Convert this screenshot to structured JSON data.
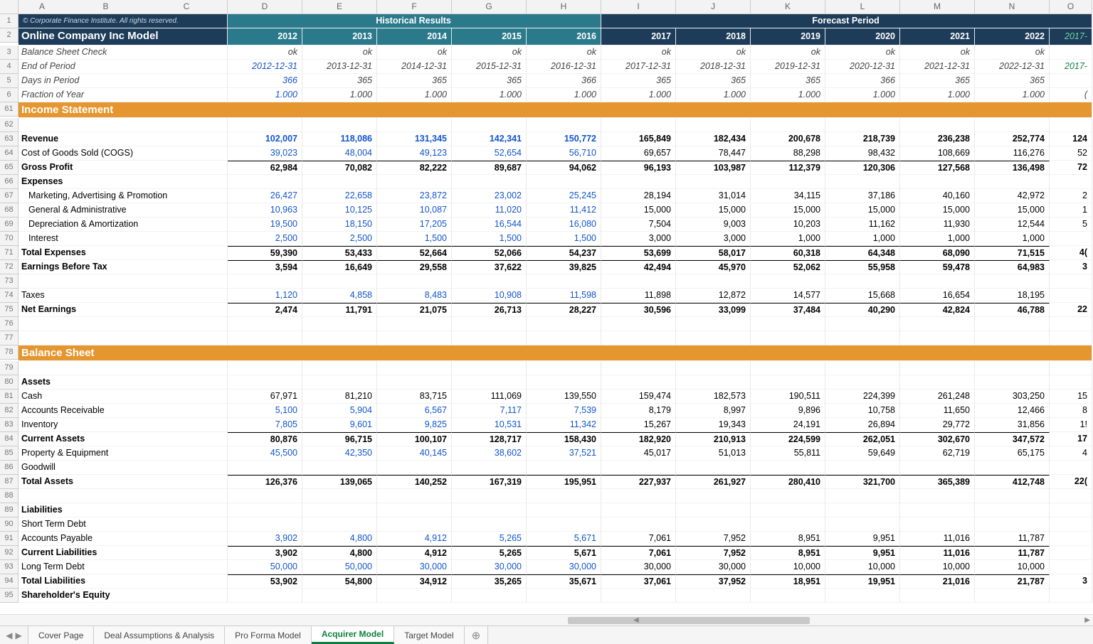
{
  "copyright": "© Corporate Finance Institute. All rights reserved.",
  "title": "Online Company Inc Model",
  "header_hist": "Historical Results",
  "header_fore": "Forecast Period",
  "cols": [
    "A",
    "B",
    "C",
    "D",
    "E",
    "F",
    "G",
    "H",
    "I",
    "J",
    "K",
    "L",
    "M",
    "N",
    "O"
  ],
  "row_ids": [
    "1",
    "2",
    "3",
    "4",
    "5",
    "6",
    "61",
    "62",
    "63",
    "64",
    "65",
    "66",
    "67",
    "68",
    "69",
    "70",
    "71",
    "72",
    "73",
    "74",
    "75",
    "76",
    "77",
    "78",
    "79",
    "80",
    "81",
    "82",
    "83",
    "84",
    "85",
    "86",
    "87",
    "88",
    "89",
    "90",
    "91",
    "92",
    "93",
    "94",
    "95"
  ],
  "years": [
    "2012",
    "2013",
    "2014",
    "2015",
    "2016",
    "2017",
    "2018",
    "2019",
    "2020",
    "2021",
    "2022"
  ],
  "year_partial_o": "2017-",
  "rows": {
    "bsc": {
      "label": "Balance Sheet Check",
      "vals": [
        "ok",
        "ok",
        "ok",
        "ok",
        "ok",
        "ok",
        "ok",
        "ok",
        "ok",
        "ok",
        "ok"
      ],
      "o": ""
    },
    "eop": {
      "label": "End of Period",
      "vals": [
        "2012-12-31",
        "2013-12-31",
        "2014-12-31",
        "2015-12-31",
        "2016-12-31",
        "2017-12-31",
        "2018-12-31",
        "2019-12-31",
        "2020-12-31",
        "2021-12-31",
        "2022-12-31"
      ],
      "o": "2017-"
    },
    "days": {
      "label": "Days in Period",
      "vals": [
        "366",
        "365",
        "365",
        "365",
        "366",
        "365",
        "365",
        "365",
        "366",
        "365",
        "365"
      ],
      "o": ""
    },
    "frac": {
      "label": "Fraction of Year",
      "vals": [
        "1.000",
        "1.000",
        "1.000",
        "1.000",
        "1.000",
        "1.000",
        "1.000",
        "1.000",
        "1.000",
        "1.000",
        "1.000"
      ],
      "o": "("
    },
    "income_hdr": "Income Statement",
    "rev": {
      "label": "Revenue",
      "vals": [
        "102,007",
        "118,086",
        "131,345",
        "142,341",
        "150,772",
        "165,849",
        "182,434",
        "200,678",
        "218,739",
        "236,238",
        "252,774"
      ],
      "o": "124"
    },
    "cogs": {
      "label": "Cost of Goods Sold (COGS)",
      "vals": [
        "39,023",
        "48,004",
        "49,123",
        "52,654",
        "56,710",
        "69,657",
        "78,447",
        "88,298",
        "98,432",
        "108,669",
        "116,276"
      ],
      "o": "52"
    },
    "gp": {
      "label": "Gross Profit",
      "vals": [
        "62,984",
        "70,082",
        "82,222",
        "89,687",
        "94,062",
        "96,193",
        "103,987",
        "112,379",
        "120,306",
        "127,568",
        "136,498"
      ],
      "o": "72"
    },
    "exp_hdr": "Expenses",
    "map": {
      "label": "Marketing, Advertising & Promotion",
      "vals": [
        "26,427",
        "22,658",
        "23,872",
        "23,002",
        "25,245",
        "28,194",
        "31,014",
        "34,115",
        "37,186",
        "40,160",
        "42,972"
      ],
      "o": "2"
    },
    "ga": {
      "label": "General & Administrative",
      "vals": [
        "10,963",
        "10,125",
        "10,087",
        "11,020",
        "11,412",
        "15,000",
        "15,000",
        "15,000",
        "15,000",
        "15,000",
        "15,000"
      ],
      "o": "1"
    },
    "da": {
      "label": "Depreciation & Amortization",
      "vals": [
        "19,500",
        "18,150",
        "17,205",
        "16,544",
        "16,080",
        "7,504",
        "9,003",
        "10,203",
        "11,162",
        "11,930",
        "12,544"
      ],
      "o": "5"
    },
    "intr": {
      "label": "Interest",
      "vals": [
        "2,500",
        "2,500",
        "1,500",
        "1,500",
        "1,500",
        "3,000",
        "3,000",
        "1,000",
        "1,000",
        "1,000",
        "1,000"
      ],
      "o": ""
    },
    "texp": {
      "label": "Total Expenses",
      "vals": [
        "59,390",
        "53,433",
        "52,664",
        "52,066",
        "54,237",
        "53,699",
        "58,017",
        "60,318",
        "64,348",
        "68,090",
        "71,515"
      ],
      "o": "4("
    },
    "ebt": {
      "label": "Earnings Before Tax",
      "vals": [
        "3,594",
        "16,649",
        "29,558",
        "37,622",
        "39,825",
        "42,494",
        "45,970",
        "52,062",
        "55,958",
        "59,478",
        "64,983"
      ],
      "o": "3"
    },
    "tax": {
      "label": "Taxes",
      "vals": [
        "1,120",
        "4,858",
        "8,483",
        "10,908",
        "11,598",
        "11,898",
        "12,872",
        "14,577",
        "15,668",
        "16,654",
        "18,195"
      ],
      "o": ""
    },
    "net": {
      "label": "Net Earnings",
      "vals": [
        "2,474",
        "11,791",
        "21,075",
        "26,713",
        "28,227",
        "30,596",
        "33,099",
        "37,484",
        "40,290",
        "42,824",
        "46,788"
      ],
      "o": "22"
    },
    "bs_hdr": "Balance Sheet",
    "assets_hdr": "Assets",
    "cash": {
      "label": "Cash",
      "vals": [
        "67,971",
        "81,210",
        "83,715",
        "111,069",
        "139,550",
        "159,474",
        "182,573",
        "190,511",
        "224,399",
        "261,248",
        "303,250"
      ],
      "o": "15"
    },
    "ar": {
      "label": "Accounts Receivable",
      "vals": [
        "5,100",
        "5,904",
        "6,567",
        "7,117",
        "7,539",
        "8,179",
        "8,997",
        "9,896",
        "10,758",
        "11,650",
        "12,466"
      ],
      "o": "8"
    },
    "inv": {
      "label": "Inventory",
      "vals": [
        "7,805",
        "9,601",
        "9,825",
        "10,531",
        "11,342",
        "15,267",
        "19,343",
        "24,191",
        "26,894",
        "29,772",
        "31,856"
      ],
      "o": "1!"
    },
    "ca": {
      "label": "Current Assets",
      "vals": [
        "80,876",
        "96,715",
        "100,107",
        "128,717",
        "158,430",
        "182,920",
        "210,913",
        "224,599",
        "262,051",
        "302,670",
        "347,572"
      ],
      "o": "17"
    },
    "pe": {
      "label": "Property & Equipment",
      "vals": [
        "45,500",
        "42,350",
        "40,145",
        "38,602",
        "37,521",
        "45,017",
        "51,013",
        "55,811",
        "59,649",
        "62,719",
        "65,175"
      ],
      "o": "4"
    },
    "gw": {
      "label": "Goodwill",
      "vals": [
        "",
        "",
        "",
        "",
        "",
        "",
        "",
        "",
        "",
        "",
        ""
      ],
      "o": ""
    },
    "ta": {
      "label": "Total Assets",
      "vals": [
        "126,376",
        "139,065",
        "140,252",
        "167,319",
        "195,951",
        "227,937",
        "261,927",
        "280,410",
        "321,700",
        "365,389",
        "412,748"
      ],
      "o": "22("
    },
    "liab_hdr": "Liabilities",
    "std": {
      "label": "Short Term Debt",
      "vals": [
        "",
        "",
        "",
        "",
        "",
        "",
        "",
        "",
        "",
        "",
        ""
      ],
      "o": ""
    },
    "ap": {
      "label": "Accounts Payable",
      "vals": [
        "3,902",
        "4,800",
        "4,912",
        "5,265",
        "5,671",
        "7,061",
        "7,952",
        "8,951",
        "9,951",
        "11,016",
        "11,787"
      ],
      "o": ""
    },
    "cl": {
      "label": "Current Liabilities",
      "vals": [
        "3,902",
        "4,800",
        "4,912",
        "5,265",
        "5,671",
        "7,061",
        "7,952",
        "8,951",
        "9,951",
        "11,016",
        "11,787"
      ],
      "o": ""
    },
    "ltd": {
      "label": "Long Term Debt",
      "vals": [
        "50,000",
        "50,000",
        "30,000",
        "30,000",
        "30,000",
        "30,000",
        "30,000",
        "10,000",
        "10,000",
        "10,000",
        "10,000"
      ],
      "o": ""
    },
    "tl": {
      "label": "Total Liabilities",
      "vals": [
        "53,902",
        "54,800",
        "34,912",
        "35,265",
        "35,671",
        "37,061",
        "37,952",
        "18,951",
        "19,951",
        "21,016",
        "21,787"
      ],
      "o": "3"
    },
    "se_hdr": "Shareholder's Equity"
  },
  "tabs": [
    "Cover Page",
    "Deal Assumptions & Analysis",
    "Pro Forma Model",
    "Acquirer Model",
    "Target Model"
  ],
  "active_tab": 3,
  "add_tab": "⊕"
}
